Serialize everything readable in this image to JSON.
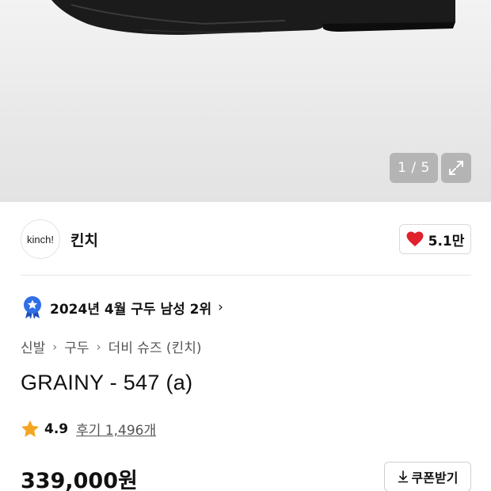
{
  "gallery": {
    "counter": "1 / 5",
    "icons": {
      "expand": "expand-icon"
    }
  },
  "brand": {
    "logo_text": "kinch!",
    "name": "킨치",
    "like_count": "5.1만",
    "like_icon": "heart-icon",
    "heart_color": "#e0202a"
  },
  "ranking": {
    "text": "2024년 4월 구두 남성 2위",
    "badge_color": "#2f6fe8",
    "icon": "ranking-badge-icon"
  },
  "breadcrumb": {
    "items": [
      "신발",
      "구두",
      "더비 슈즈 (킨치)"
    ]
  },
  "product": {
    "title": "GRAINY - 547 (a)"
  },
  "rating": {
    "score": "4.9",
    "review_label": "후기 1,496개",
    "star_color": "#f4a623"
  },
  "price": {
    "amount": "339,000원"
  },
  "coupon": {
    "label": "쿠폰받기",
    "icon": "download-icon"
  }
}
